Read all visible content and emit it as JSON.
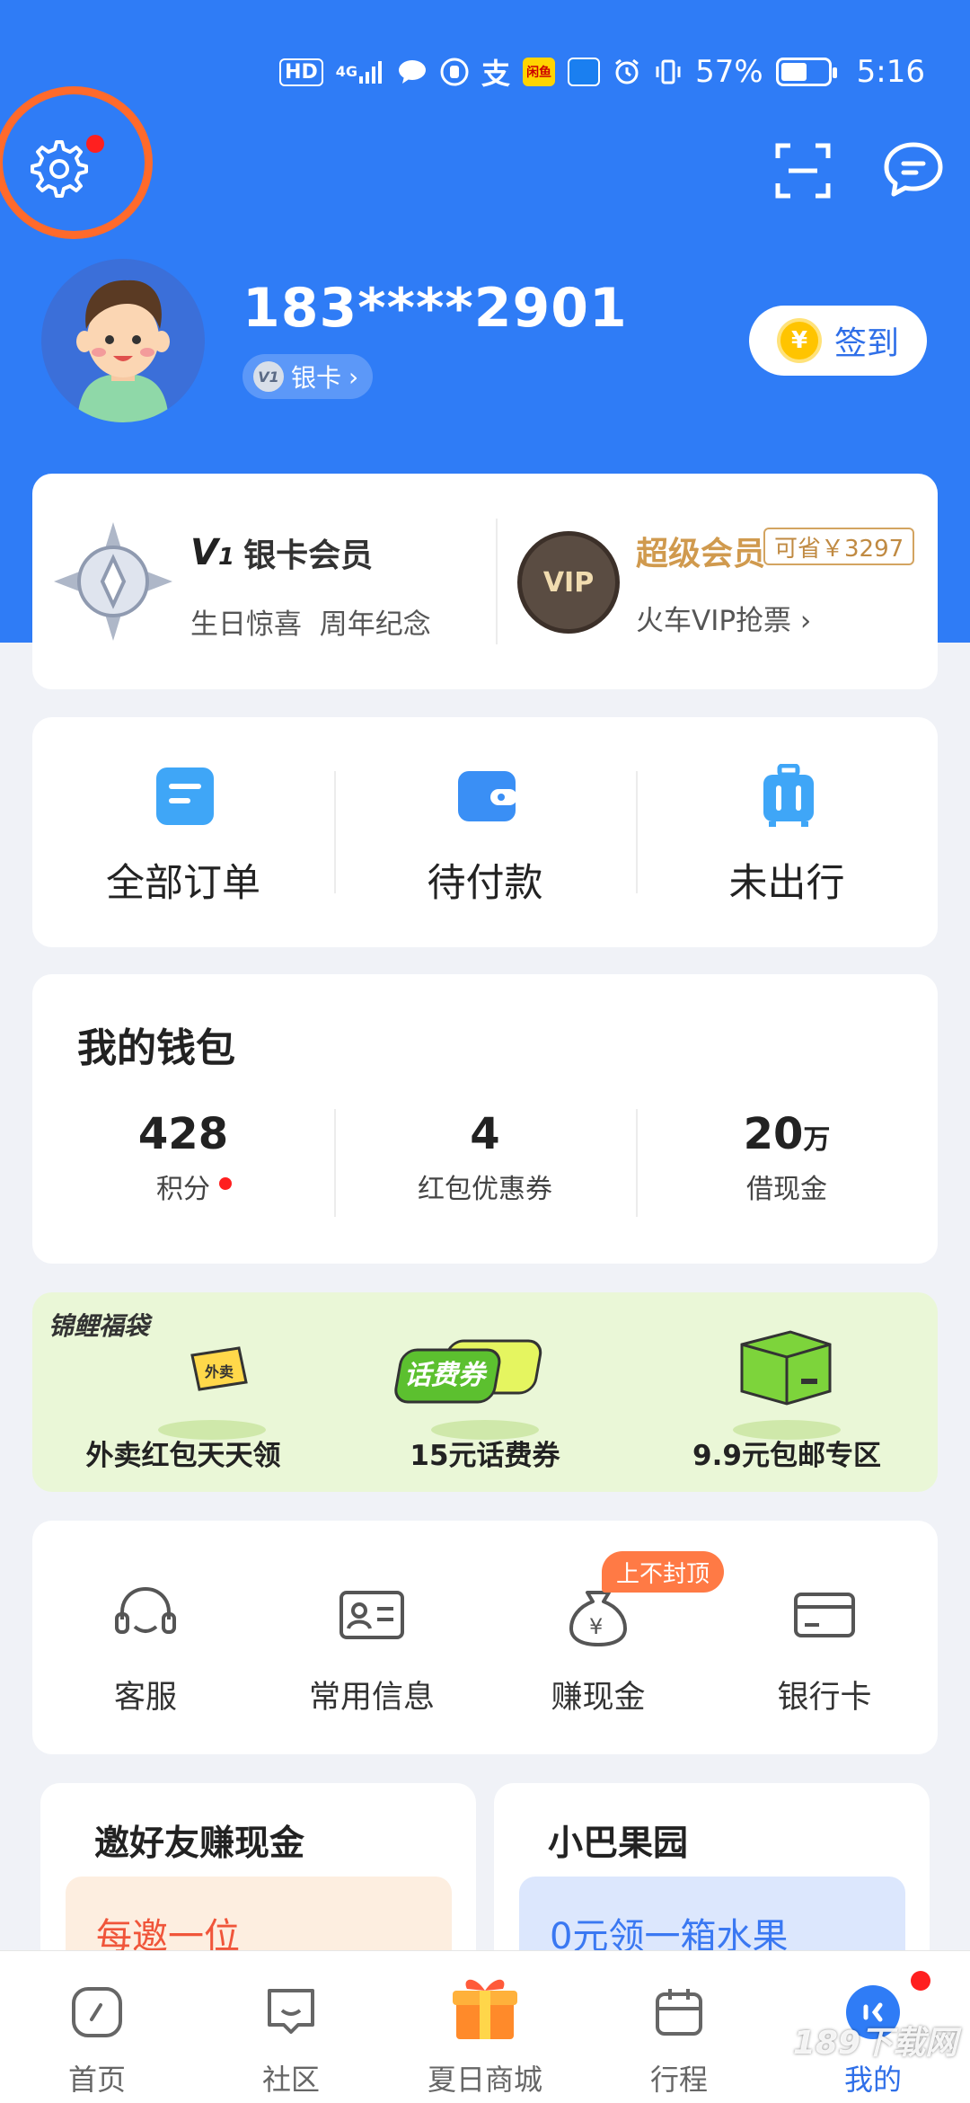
{
  "status_bar": {
    "hd": "HD",
    "network": "4G",
    "battery_percent": "57%",
    "battery_level": 0.57,
    "time": "5:16",
    "app_badge_text": "闲鱼",
    "icons": [
      "hd-icon",
      "signal-icon",
      "chat-bubble-icon",
      "hand-icon",
      "alipay-icon",
      "app-badge-icon",
      "weather-icon",
      "alarm-icon",
      "vibrate-icon",
      "battery-icon"
    ]
  },
  "header": {
    "settings_icon": "gear-icon",
    "scan_icon": "scan-icon",
    "message_icon": "message-icon",
    "accent_color": "#2f7cf6",
    "highlight_ring_color": "#ff6a2b"
  },
  "profile": {
    "phone": "183****2901",
    "member_badge": "V1",
    "member_level": "银卡",
    "checkin_coin": "¥",
    "checkin_label": "签到"
  },
  "vip": {
    "badge": "V",
    "level": "1",
    "title": "银卡会员",
    "benefit_1": "生日惊喜",
    "benefit_2": "周年纪念",
    "super_title": "超级会员",
    "save_text": "可省￥3297",
    "medal_text": "VIP",
    "super_sub": "火车VIP抢票 ›"
  },
  "orders": {
    "items": [
      {
        "label": "全部订单",
        "icon": "document-icon"
      },
      {
        "label": "待付款",
        "icon": "wallet-icon"
      },
      {
        "label": "未出行",
        "icon": "luggage-icon"
      }
    ]
  },
  "wallet": {
    "title": "我的钱包",
    "items": [
      {
        "value": "428",
        "unit": "",
        "label": "积分"
      },
      {
        "value": "4",
        "unit": "",
        "label": "红包优惠券"
      },
      {
        "value": "20",
        "unit": "万",
        "label": "借现金"
      }
    ]
  },
  "promo": {
    "tag": "锦鲤福袋",
    "ticket_text": "外卖",
    "voucher_text": "话费券",
    "items": [
      {
        "label": "外卖红包天天领"
      },
      {
        "label": "15元话费券"
      },
      {
        "label": "9.9元包邮专区"
      }
    ]
  },
  "services": {
    "items": [
      {
        "label": "客服",
        "icon": "headset-icon"
      },
      {
        "label": "常用信息",
        "icon": "id-card-icon"
      },
      {
        "label": "赚现金",
        "icon": "money-bag-icon"
      },
      {
        "label": "银行卡",
        "icon": "bank-card-icon"
      }
    ],
    "cash_tag": "上不封顶"
  },
  "invite": {
    "title": "邀好友赚现金",
    "sub": "每邀一位"
  },
  "orchard": {
    "title": "小巴果园",
    "sub": "0元领一箱水果"
  },
  "tabbar": {
    "items": [
      {
        "label": "首页",
        "icon": "home-icon"
      },
      {
        "label": "社区",
        "icon": "community-icon"
      },
      {
        "label": "夏日商城",
        "icon": "gift-icon"
      },
      {
        "label": "行程",
        "icon": "calendar-icon"
      },
      {
        "label": "我的",
        "icon": "profile-face-icon"
      }
    ],
    "active_index": 4
  },
  "watermark": "189下载网"
}
